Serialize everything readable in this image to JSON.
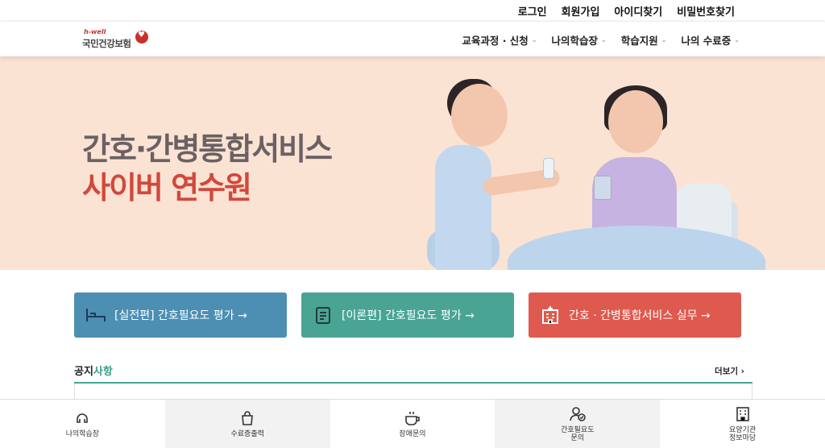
{
  "util_nav": [
    "로그인",
    "회원가입",
    "아이디찾기",
    "비밀번호찾기"
  ],
  "logo": {
    "small": "h-well",
    "name": "국민건강보험"
  },
  "menu": [
    {
      "label": "교육과정 · 신청"
    },
    {
      "label": "나의학습장"
    },
    {
      "label": "학습지원"
    },
    {
      "label": "나의 수료증"
    }
  ],
  "hero": {
    "line1": "간호·간병통합서비스",
    "line2": "사이버 연수원"
  },
  "quick": [
    {
      "label": "[실전편] 간호필요도 평가 →",
      "icon": "bed-icon",
      "color": "#4c8fb3"
    },
    {
      "label": "[이론편] 간호필요도 평가 →",
      "icon": "clipboard-icon",
      "color": "#4aa494"
    },
    {
      "label": "간호 · 간병통합서비스 실무 →",
      "icon": "hospital-icon",
      "color": "#de5a4f"
    }
  ],
  "notice": {
    "title_a": "공지",
    "title_b": "사항",
    "more": "더보기 ›"
  },
  "dock": [
    {
      "label": "나의학습장",
      "icon": "headset-icon"
    },
    {
      "label": "수료증출력",
      "icon": "bag-icon"
    },
    {
      "label": "장애문의",
      "icon": "cup-icon"
    },
    {
      "label": "간호필요도\n문의",
      "icon": "user-check-icon"
    },
    {
      "label": "요양기관\n정보마당",
      "icon": "building-icon"
    }
  ]
}
